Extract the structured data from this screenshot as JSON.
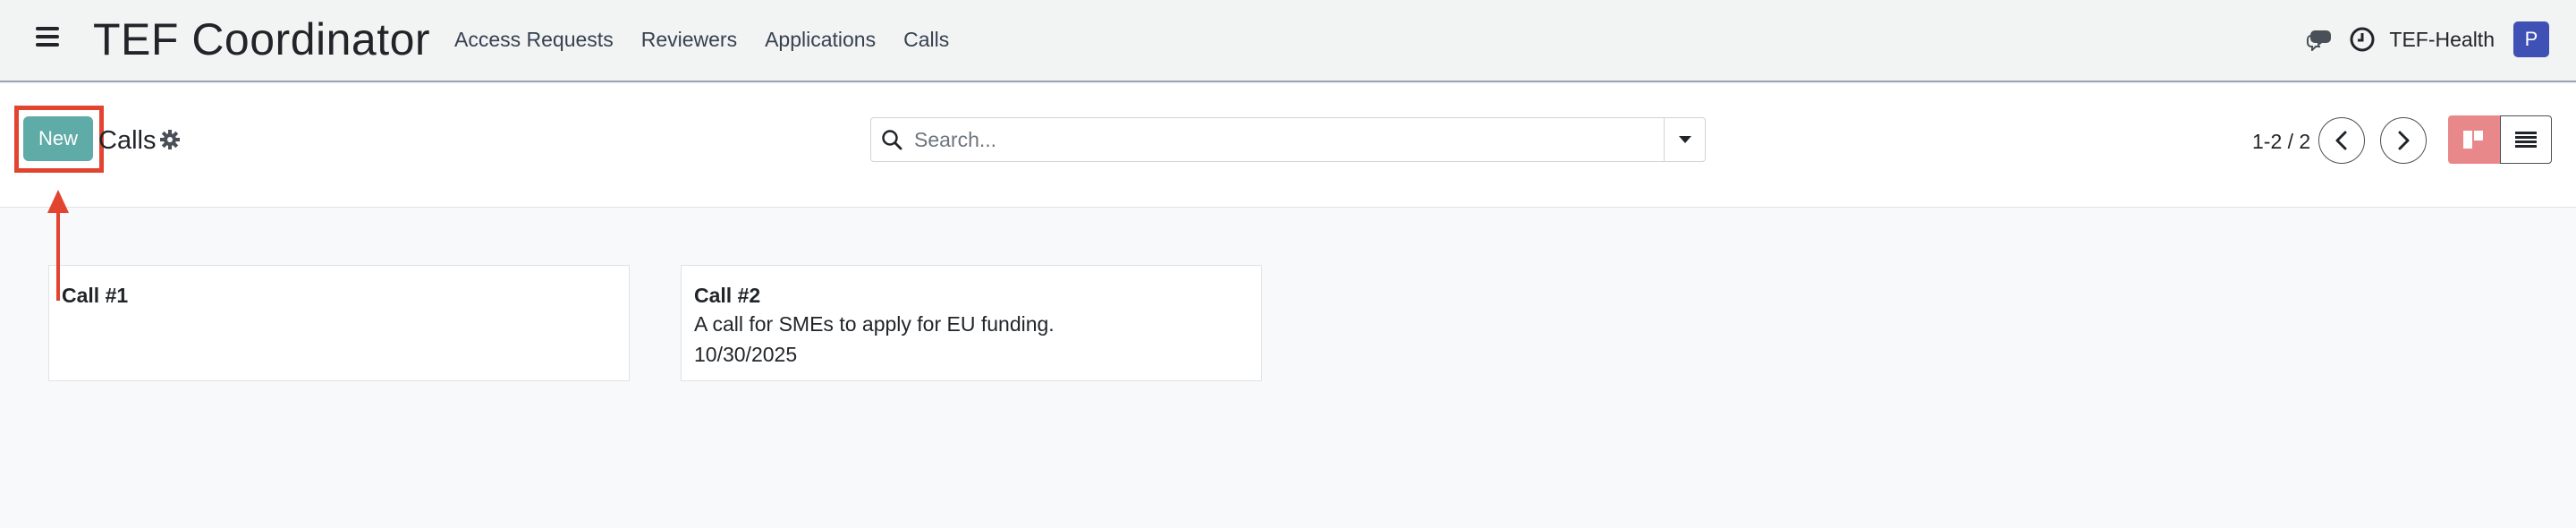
{
  "navbar": {
    "app_title": "TEF Coordinator",
    "menu": [
      "Access Requests",
      "Reviewers",
      "Applications",
      "Calls"
    ],
    "company": "TEF-Health",
    "avatar_initial": "P"
  },
  "control_panel": {
    "new_label": "New",
    "breadcrumb": "Calls",
    "search_placeholder": "Search...",
    "pager_value": "1-2 / 2"
  },
  "cards": [
    {
      "title": "Call #1"
    },
    {
      "title": "Call #2",
      "description": "A call for SMEs to apply for EU funding.",
      "date": "10/30/2025"
    }
  ],
  "colors": {
    "primary": "#5eaba7",
    "annotation": "#e2442f",
    "avatar": "#3f51b5",
    "kanban_active": "#e8888a"
  },
  "icons": [
    "hamburger-icon",
    "chat-icon",
    "clock-icon",
    "gear-icon",
    "search-icon",
    "caret-down-icon",
    "chevron-left-icon",
    "chevron-right-icon",
    "kanban-icon",
    "list-icon",
    "annotation-arrow"
  ]
}
